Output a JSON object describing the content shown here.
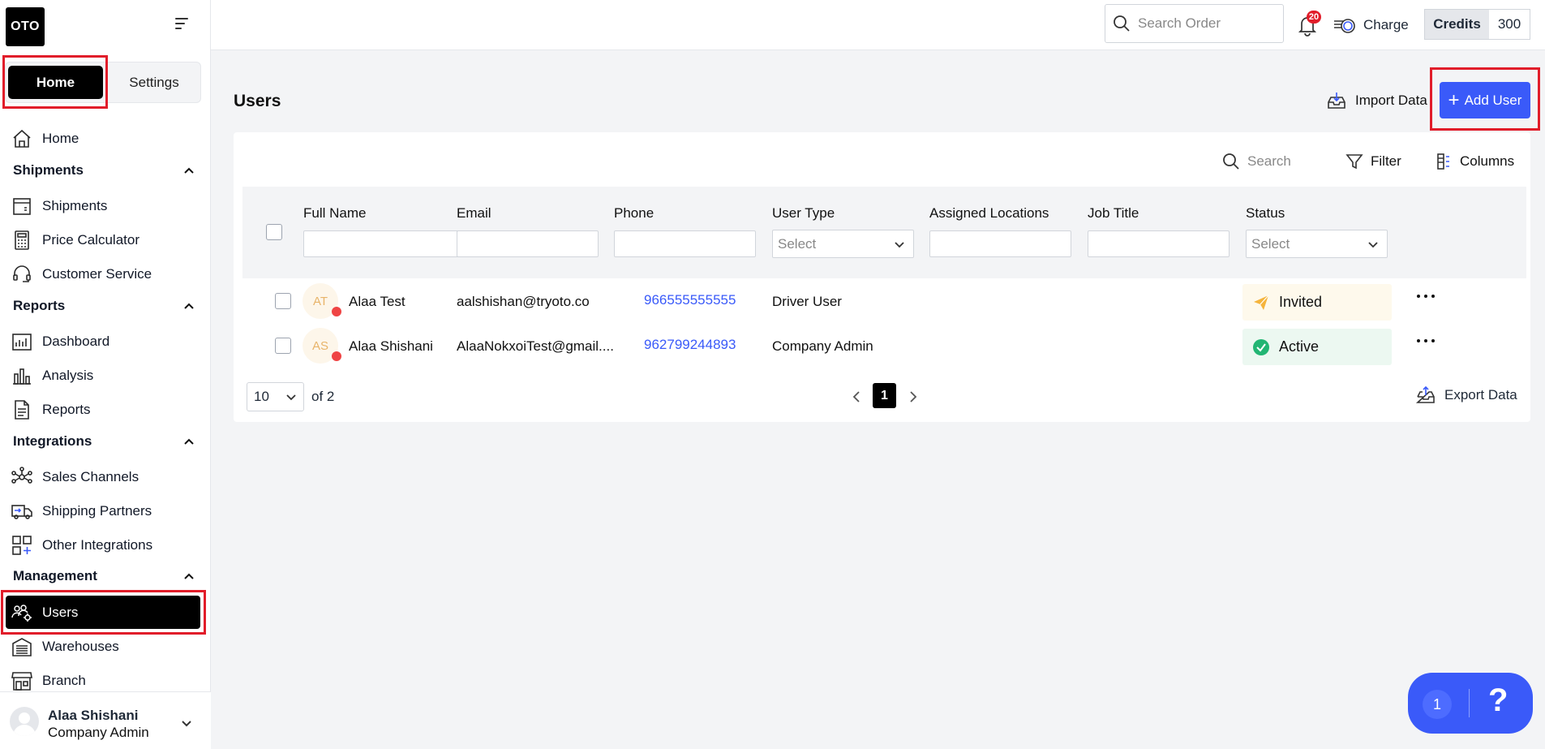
{
  "brand": {
    "logo_text": "OTO"
  },
  "mode_switch": {
    "home": "Home",
    "settings": "Settings"
  },
  "sidebar": {
    "top_item": {
      "label": "Home",
      "icon": "house-icon"
    },
    "sections": [
      {
        "title": "Shipments",
        "items": [
          "Shipments",
          "Price Calculator",
          "Customer Service"
        ]
      },
      {
        "title": "Reports",
        "items": [
          "Dashboard",
          "Analysis",
          "Reports"
        ]
      },
      {
        "title": "Integrations",
        "items": [
          "Sales Channels",
          "Shipping Partners",
          "Other Integrations"
        ]
      },
      {
        "title": "Management",
        "items": [
          "Users",
          "Warehouses",
          "Branch"
        ]
      }
    ],
    "active_item": "Users"
  },
  "current_user": {
    "name": "Alaa Shishani",
    "role": "Company Admin"
  },
  "topbar": {
    "search_placeholder": "Search Order",
    "notification_count": "20",
    "charge_label": "Charge",
    "credits_label": "Credits",
    "credits_value": "300"
  },
  "page": {
    "title": "Users",
    "import_label": "Import Data",
    "add_user_label": "Add User"
  },
  "toolbar": {
    "search_placeholder": "Search",
    "filter_label": "Filter",
    "columns_label": "Columns"
  },
  "table": {
    "columns": [
      "Full Name",
      "Email",
      "Phone",
      "User Type",
      "Assigned Locations",
      "Job Title",
      "Status"
    ],
    "select_placeholder": "Select",
    "rows": [
      {
        "initials": "AT",
        "name": "Alaa Test",
        "email": "aalshishan@tryoto.co",
        "phone": "966555555555",
        "user_type": "Driver User",
        "status": "Invited"
      },
      {
        "initials": "AS",
        "name": "Alaa Shishani",
        "email": "AlaaNokxoiTest@gmail....",
        "phone": "962799244893",
        "user_type": "Company Admin",
        "status": "Active"
      }
    ]
  },
  "pagination": {
    "page_size": "10",
    "of_total": "of 2",
    "current_page": "1"
  },
  "export_label": "Export Data",
  "help_widget": {
    "count": "1",
    "symbol": "?"
  },
  "colors": {
    "accent": "#3a5af9",
    "highlight_box": "#e11d2a",
    "invited_icon": "#f5b43c",
    "active_icon": "#22b573"
  }
}
